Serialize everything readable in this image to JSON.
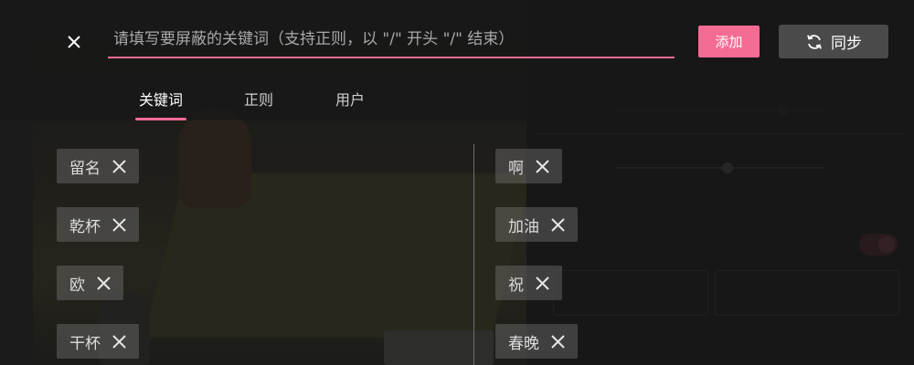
{
  "header": {
    "close_icon": "close-icon",
    "search": {
      "value": "",
      "placeholder": "请填写要屏蔽的关键词（支持正则，以 \"/\" 开头 \"/\" 结束）"
    },
    "add_label": "添加",
    "sync_label": "同步",
    "sync_icon": "sync-icon"
  },
  "tabs": [
    {
      "label": "关键词",
      "active": true
    },
    {
      "label": "正则",
      "active": false
    },
    {
      "label": "用户",
      "active": false
    }
  ],
  "keywords": {
    "left": [
      {
        "text": "留名"
      },
      {
        "text": "乾杯"
      },
      {
        "text": "欧"
      },
      {
        "text": "干杯"
      }
    ],
    "right": [
      {
        "text": "啊"
      },
      {
        "text": "加油"
      },
      {
        "text": "祝"
      },
      {
        "text": "春晚"
      }
    ]
  },
  "colors": {
    "accent": "#f46c94",
    "chip_bg": "#787878",
    "sync_bg": "#4a4a4a"
  }
}
